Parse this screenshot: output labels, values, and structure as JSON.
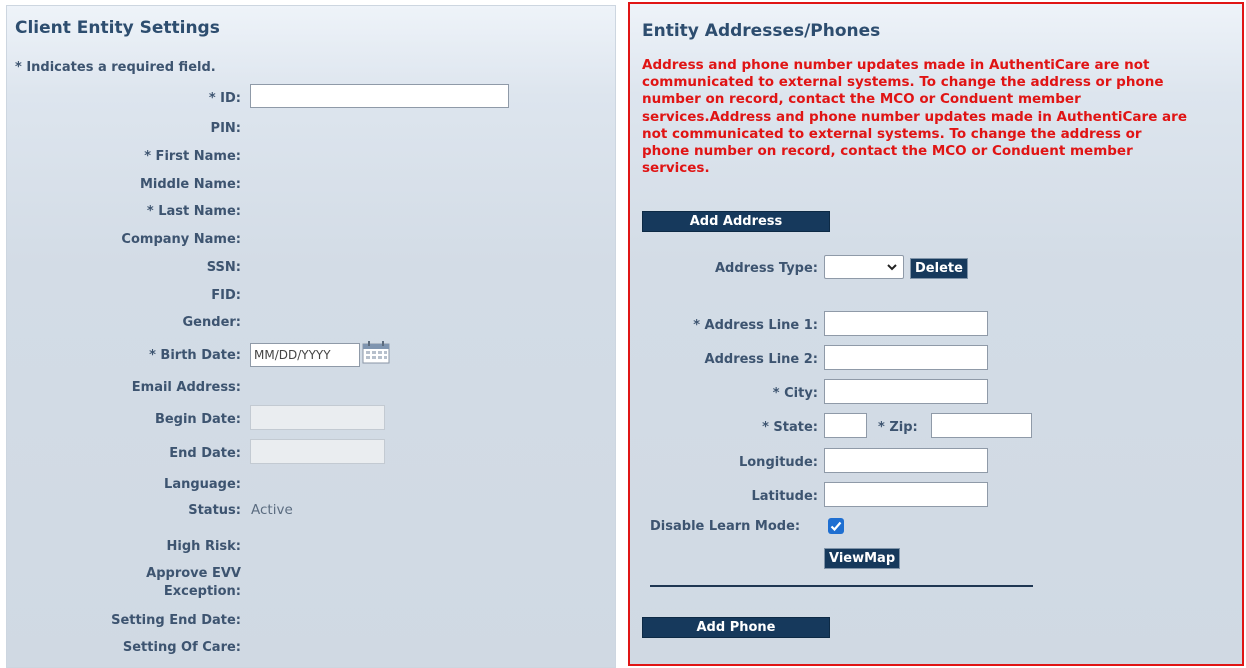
{
  "left": {
    "title": "Client Entity Settings",
    "required_note": "* Indicates a required field.",
    "labels": {
      "id": "* ID:",
      "pin": "PIN:",
      "first_name": "* First Name:",
      "middle_name": "Middle Name:",
      "last_name": "* Last Name:",
      "company_name": "Company Name:",
      "ssn": "SSN:",
      "fid": "FID:",
      "gender": "Gender:",
      "birth_date": "* Birth Date:",
      "email": "Email Address:",
      "begin_date": "Begin Date:",
      "end_date": "End Date:",
      "language": "Language:",
      "status": "Status:",
      "high_risk": "High Risk:",
      "approve_evv_1": "Approve EVV",
      "approve_evv_2": "Exception:",
      "setting_end_date": "Setting End Date:",
      "setting_of_care": "Setting Of Care:"
    },
    "id_value": "",
    "birth_date_placeholder": "MM/DD/YYYY",
    "status_value": "Active"
  },
  "right": {
    "title": "Entity Addresses/Phones",
    "warning_lines": [
      "Address and phone number updates made in AuthentiCare are not",
      "communicated to external systems. To change the address or phone",
      "number on record, contact the MCO or Conduent member",
      "services.Address and phone number updates made in AuthentiCare are",
      "not communicated to external systems. To change the address or",
      "phone number on record, contact the MCO or Conduent member",
      "services."
    ],
    "add_address_label": "Add Address",
    "address_type_label": "Address Type:",
    "address_type_value": "",
    "delete_label": "Delete",
    "address_line1_label": "* Address Line 1:",
    "address_line2_label": "Address Line 2:",
    "city_label": "* City:",
    "state_label": "* State:",
    "zip_label": "* Zip:",
    "longitude_label": "Longitude:",
    "latitude_label": "Latitude:",
    "disable_learn_label": "Disable Learn Mode:",
    "disable_learn_checked": true,
    "viewmap_label": "ViewMap",
    "add_phone_label": "Add Phone"
  },
  "colors": {
    "label": "#3d5470",
    "title": "#2d4d6f",
    "warning": "#e01414",
    "button_bg": "#16395c",
    "checkbox": "#1f6fd1"
  }
}
